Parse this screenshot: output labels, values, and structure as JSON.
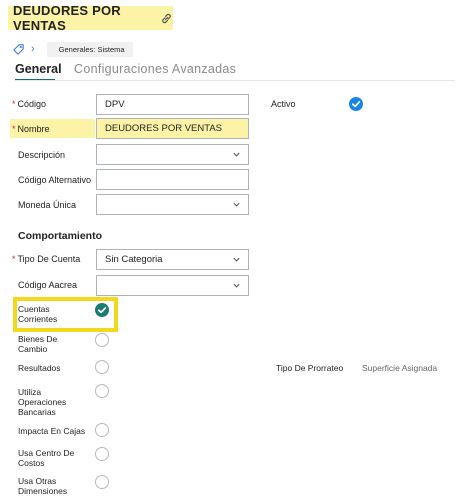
{
  "header": {
    "title": "DEUDORES POR VENTAS",
    "title_icon": "link-icon",
    "breadcrumb": "Generales: Sistema",
    "breadcrumb_icon": "tag-icon",
    "breadcrumb_chevron": "›"
  },
  "tabs": [
    {
      "label": "General",
      "active": true
    },
    {
      "label": "Configuraciones Avanzadas",
      "active": false
    }
  ],
  "form": {
    "codigo": {
      "label": "Código",
      "value": "DPV",
      "required": true
    },
    "activo": {
      "label": "Activo",
      "checked": true
    },
    "nombre": {
      "label": "Nombre",
      "value": "DEUDORES POR VENTAS",
      "required": true
    },
    "descripcion": {
      "label": "Descripción",
      "value": ""
    },
    "codigo_alternativo": {
      "label": "Código Alternativo",
      "value": ""
    },
    "moneda_unica": {
      "label": "Moneda Única",
      "value": ""
    }
  },
  "comportamiento": {
    "title": "Comportamiento",
    "tipo_cuenta": {
      "label": "Tipo De Cuenta",
      "value": "Sin Categoria",
      "required": true
    },
    "codigo_aacrea": {
      "label": "Código Aacrea",
      "value": ""
    },
    "cuentas_corrientes": {
      "label_line1": "Cuentas",
      "label_line2": "Corrientes",
      "checked": true
    },
    "bienes_de_cambio": {
      "label_line1": "Bienes De",
      "label_line2": "Cambio",
      "checked": false
    },
    "resultados": {
      "label": "Resultados",
      "checked": false
    },
    "tipo_prorrateo": {
      "label": "Tipo De Prorrateo",
      "value": "Superficie Asignada"
    },
    "utiliza_operaciones": {
      "label_line1": "Utiliza",
      "label_line2": "Operaciones",
      "label_line3": "Bancarias",
      "checked": false
    },
    "impacta_cajas": {
      "label": "Impacta En Cajas",
      "checked": false
    },
    "usa_centro_costos": {
      "label_line1": "Usa Centro De",
      "label_line2": "Costos",
      "checked": false
    },
    "usa_otras_dimensiones": {
      "label_line1": "Usa Otras",
      "label_line2": "Dimensiones",
      "checked": false
    }
  },
  "colors": {
    "highlight": "#fdf3a6",
    "accent_teal": "#0e6e76",
    "check_blue": "#1a84e8",
    "check_teal": "#1b7b72",
    "required": "#d32f2f",
    "focus_box": "#f3d81e"
  }
}
